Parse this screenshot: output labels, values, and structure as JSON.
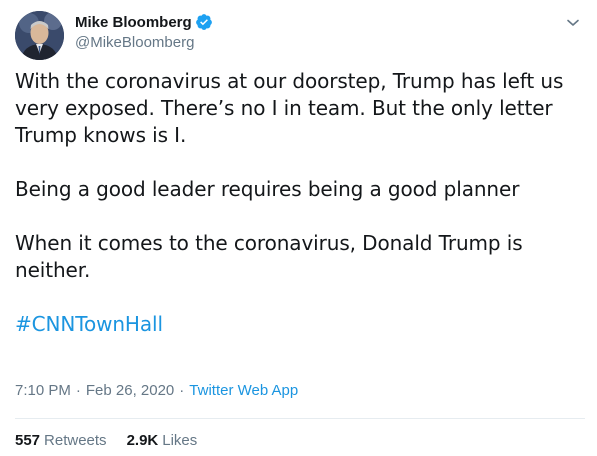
{
  "author": {
    "display_name": "Mike Bloomberg",
    "handle": "@MikeBloomberg",
    "verified": true
  },
  "tweet": {
    "paragraphs": [
      "With the coronavirus at our doorstep, Trump has left us very exposed. There’s no I in team. But the only letter Trump knows is I.",
      "Being a good leader requires being a good planner",
      "When it comes to the coronavirus, Donald Trump is neither."
    ],
    "hashtag": "#CNNTownHall"
  },
  "meta": {
    "time": "7:10 PM",
    "separator": "·",
    "date": "Feb 26, 2020",
    "source": "Twitter Web App"
  },
  "stats": {
    "retweets_count": "557",
    "retweets_label": "Retweets",
    "likes_count": "2.9K",
    "likes_label": "Likes"
  },
  "colors": {
    "accent": "#1b95e0",
    "text": "#14171a",
    "secondary": "#657786",
    "divider": "#e6ecf0",
    "verified": "#1da1f2"
  },
  "icons": {
    "verified": "verified-badge-icon",
    "caret": "chevron-down-icon",
    "avatar": "avatar"
  }
}
